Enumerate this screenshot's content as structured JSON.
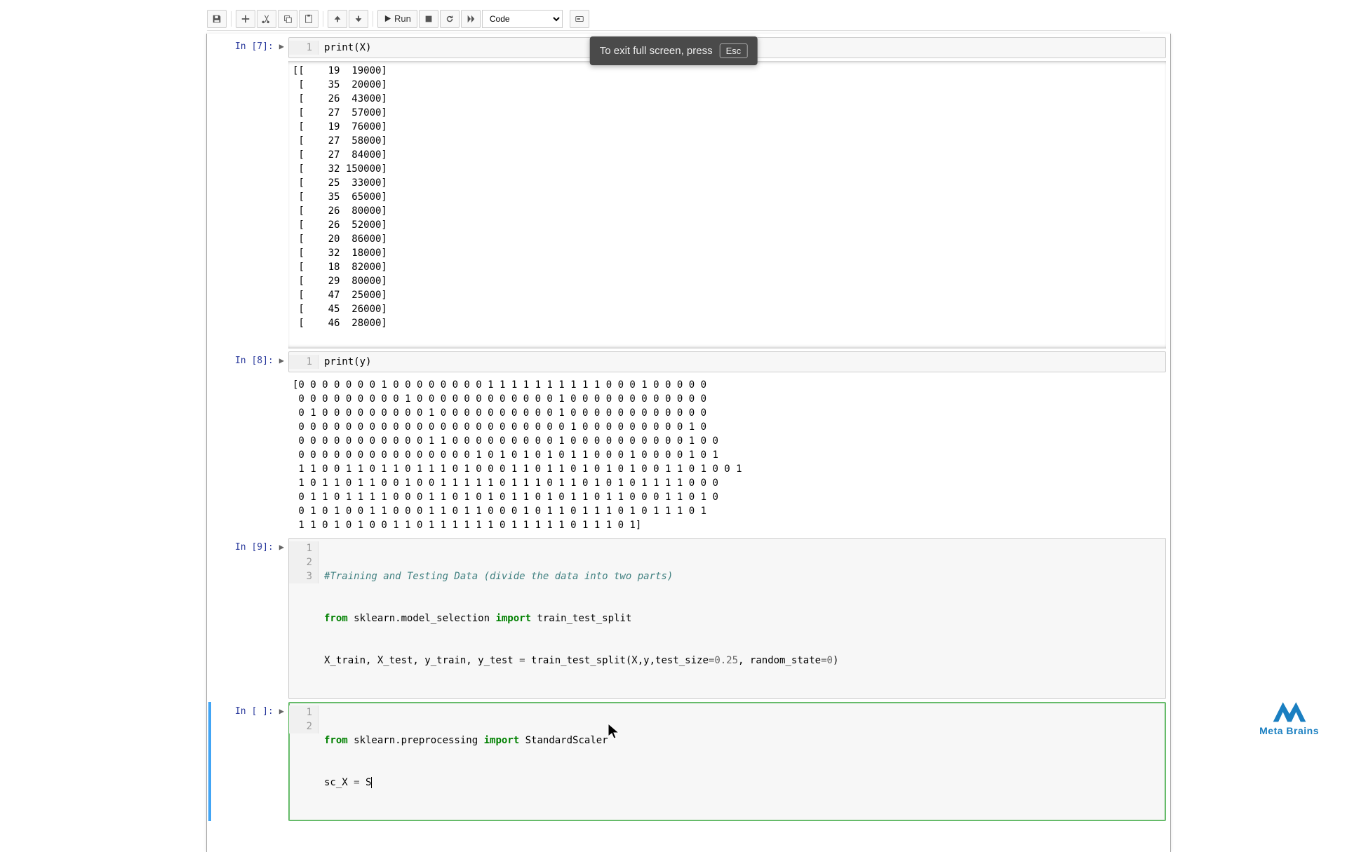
{
  "toolbar": {
    "run_label": "Run",
    "celltype": "Code"
  },
  "tooltip": {
    "text": "To exit full screen, press",
    "key": "Esc"
  },
  "cells": {
    "c1": {
      "prompt": "In [7]:",
      "lines": [
        "1"
      ],
      "code_html": [
        "print(X)"
      ]
    },
    "out1": [
      "[[    19  19000]",
      " [    35  20000]",
      " [    26  43000]",
      " [    27  57000]",
      " [    19  76000]",
      " [    27  58000]",
      " [    27  84000]",
      " [    32 150000]",
      " [    25  33000]",
      " [    35  65000]",
      " [    26  80000]",
      " [    26  52000]",
      " [    20  86000]",
      " [    32  18000]",
      " [    18  82000]",
      " [    29  80000]",
      " [    47  25000]",
      " [    45  26000]",
      " [    46  28000]"
    ],
    "c2": {
      "prompt": "In [8]:",
      "lines": [
        "1"
      ],
      "code_html": [
        "print(y)"
      ]
    },
    "out2": [
      "[0 0 0 0 0 0 0 1 0 0 0 0 0 0 0 0 1 1 1 1 1 1 1 1 1 1 0 0 0 1 0 0 0 0 0",
      " 0 0 0 0 0 0 0 0 0 1 0 0 0 0 0 0 0 0 0 0 0 0 1 0 0 0 0 0 0 0 0 0 0 0 0",
      " 0 1 0 0 0 0 0 0 0 0 0 1 0 0 0 0 0 0 0 0 0 0 1 0 0 0 0 0 0 0 0 0 0 0 0",
      " 0 0 0 0 0 0 0 0 0 0 0 0 0 0 0 0 0 0 0 0 0 0 0 1 0 0 0 0 0 0 0 0 0 1 0",
      " 0 0 0 0 0 0 0 0 0 0 0 1 1 0 0 0 0 0 0 0 0 0 1 0 0 0 0 0 0 0 0 0 0 1 0 0",
      " 0 0 0 0 0 0 0 0 0 0 0 0 0 0 0 1 0 1 0 1 0 1 0 1 1 0 0 0 1 0 0 0 0 1 0 1",
      " 1 1 0 0 1 1 0 1 1 0 1 1 1 0 1 0 0 0 1 1 0 1 1 0 1 0 1 0 1 0 0 1 1 0 1 0 0 1",
      " 1 0 1 1 0 1 1 0 0 1 0 0 1 1 1 1 1 0 1 1 1 0 1 1 0 1 0 1 0 1 1 1 1 0 0 0",
      " 0 1 1 0 1 1 1 1 0 0 0 1 1 0 1 0 1 0 1 1 0 1 0 1 1 0 1 1 0 0 0 1 1 0 1 0",
      " 0 1 0 1 0 0 1 1 0 0 0 1 1 0 1 1 0 0 0 1 0 1 1 0 1 1 1 0 1 0 1 1 1 0 1",
      " 1 1 0 1 0 1 0 0 1 1 0 1 1 1 1 1 1 0 1 1 1 1 1 0 1 1 1 0 1]"
    ],
    "c3": {
      "prompt": "In [9]:",
      "lines": [
        "1",
        "2",
        "3"
      ]
    },
    "c4": {
      "prompt": "In [ ]:",
      "lines": [
        "1",
        "2"
      ]
    }
  },
  "code3": {
    "l1_comment": "#Training and Testing Data (divide the data into two parts)",
    "l2_a": "from",
    "l2_b": " sklearn.model_selection ",
    "l2_c": "import",
    "l2_d": " train_test_split",
    "l3_a": "X_train, X_test, y_train, y_test ",
    "l3_b": "=",
    "l3_c": " train_test_split(X,y,test_size",
    "l3_d": "=",
    "l3_e": "0.25",
    "l3_f": ", random_state",
    "l3_g": "=",
    "l3_h": "0",
    "l3_i": ")"
  },
  "code4": {
    "l1_a": "from",
    "l1_b": " sklearn.preprocessing ",
    "l1_c": "import",
    "l1_d": " StandardScaler",
    "l2_a": "sc_X ",
    "l2_b": "=",
    "l2_c": " S"
  },
  "logo": "Meta Brains"
}
